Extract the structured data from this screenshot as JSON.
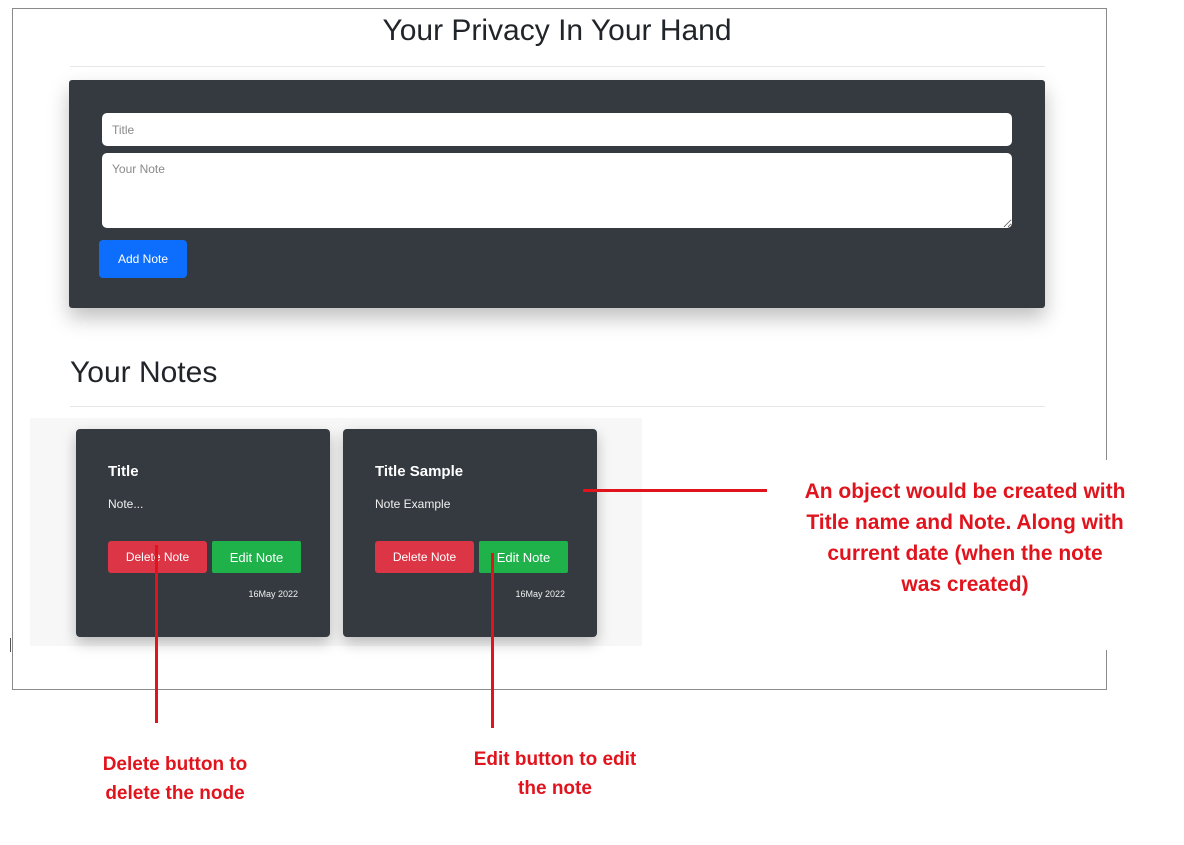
{
  "app": {
    "title": "Your Privacy In Your Hand"
  },
  "form": {
    "title_placeholder": "Title",
    "note_placeholder": "Your Note",
    "add_label": "Add Note"
  },
  "notes": {
    "heading": "Your Notes",
    "items": [
      {
        "title": "Title",
        "text": "Note...",
        "delete_label": "Delete Note",
        "edit_label": "Edit Note",
        "date": "16May 2022"
      },
      {
        "title": "Title Sample",
        "text": "Note Example",
        "delete_label": "Delete Note",
        "edit_label": "Edit Note",
        "date": "16May 2022"
      }
    ]
  },
  "annotations": {
    "object_lines": [
      "An object would be created with",
      "Title name and Note. Along with",
      "current date (when the note",
      "was created)"
    ],
    "delete_lines": [
      "Delete button to",
      "delete the node"
    ],
    "edit_lines": [
      "Edit button to edit",
      "the note"
    ]
  },
  "colors": {
    "card_bg": "#343a40",
    "primary": "#0d6efd",
    "danger": "#dc3545",
    "success": "#1fb24a",
    "annotation": "#e1141d"
  }
}
